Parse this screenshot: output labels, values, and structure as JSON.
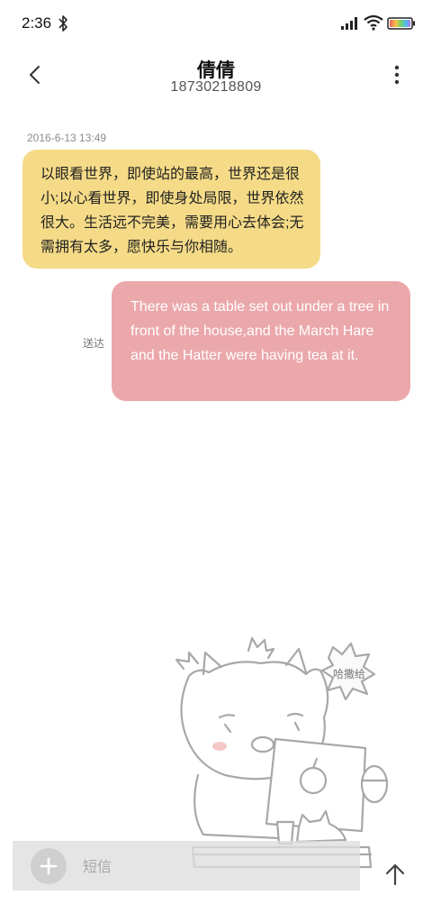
{
  "status_bar": {
    "time": "2:36",
    "icons": [
      "bluetooth-icon",
      "signal-icon",
      "wifi-icon",
      "battery-icon"
    ]
  },
  "header": {
    "contact_name": "倩倩",
    "contact_number": "18730218809",
    "icons": [
      "back-icon",
      "more-icon"
    ]
  },
  "conversation": {
    "timestamp": "2016-6-13 13:49",
    "incoming_message": "以眼看世界，即使站的最高，世界还是很小;以心看世界，即使身处局限，世界依然很大。生活远不完美，需要用心去体会;无需拥有太多，愿快乐与你相随。",
    "outgoing_message": "There was a table set out under a tree in front of the house,and the March Hare and the Hatter were having tea at it.",
    "delivery_status": "送达"
  },
  "illustration": {
    "speech_text": "哈撒给"
  },
  "composer": {
    "placeholder": "短信",
    "icons": [
      "add-icon",
      "send-arrow-icon"
    ]
  },
  "colors": {
    "incoming_bubble": "#f5db87",
    "outgoing_bubble": "#eba8ab",
    "input_bar": "#dedede"
  }
}
